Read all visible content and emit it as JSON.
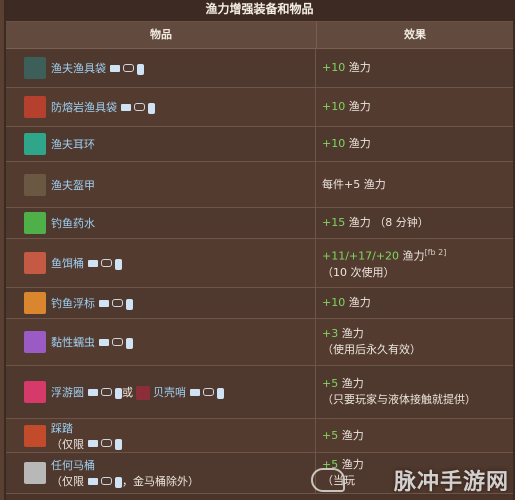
{
  "title": "渔力增强装备和物品",
  "headers": {
    "item": "物品",
    "effect": "效果"
  },
  "rows": [
    {
      "name": "渔夫渔具袋",
      "plat": true,
      "effect": [
        "+10 渔力"
      ],
      "icon": "tackle-bag-icon",
      "color": "#3d5f5a"
    },
    {
      "name": "防熔岩渔具袋",
      "plat": true,
      "effect": [
        "+10 渔力"
      ],
      "icon": "lavaproof-tackle-bag-icon",
      "color": "#b5402e"
    },
    {
      "name": "渔夫耳环",
      "plat": false,
      "effect": [
        "+10 渔力"
      ],
      "icon": "earring-icon",
      "color": "#2fa58a"
    },
    {
      "name": "渔夫盔甲",
      "plat": false,
      "effect": [
        "每件+5 渔力"
      ],
      "icon": "armor-icon",
      "color": "#6b5842"
    },
    {
      "name": "钓鱼药水",
      "plat": false,
      "effect": [
        "+15 渔力 （8 分钟）"
      ],
      "icon": "potion-icon",
      "color": "#4fb04a"
    },
    {
      "name": "鱼饵桶",
      "plat": true,
      "effect": [
        "+11/+17/+20 渔力",
        "（10 次使用）"
      ],
      "sup": "[fb 2]",
      "icon": "bait-bucket-icon",
      "color": "#c45a44"
    },
    {
      "name": "钓鱼浮标",
      "plat": true,
      "effect": [
        "+10 渔力"
      ],
      "icon": "bobber-icon",
      "color": "#d9862f"
    },
    {
      "name": "黏性蠕虫",
      "plat": true,
      "effect": [
        "+3 渔力",
        "（使用后永久有效）"
      ],
      "icon": "worm-icon",
      "color": "#9a5cc4"
    },
    {
      "name": "浮游圈",
      "plat": true,
      "extra": "贝壳哨",
      "effect": [
        "+5 渔力",
        "（只要玩家与液体接触就提供）"
      ],
      "icon": "float-ring-icon",
      "color": "#d63a6a"
    },
    {
      "name": "踩踏",
      "plat": false,
      "note": "（仅限",
      "effect": [
        "+5 渔力"
      ],
      "icon": "trap-icon",
      "color": "#c24b2c"
    },
    {
      "name": "任何马桶",
      "plat": false,
      "note": "（仅限",
      "note2": "，金马桶除外）",
      "effect": [
        "+5 渔力",
        "（当玩"
      ],
      "icon": "toilet-icon",
      "color": "#b8b8b8"
    }
  ],
  "watermark": "脉冲手游网"
}
